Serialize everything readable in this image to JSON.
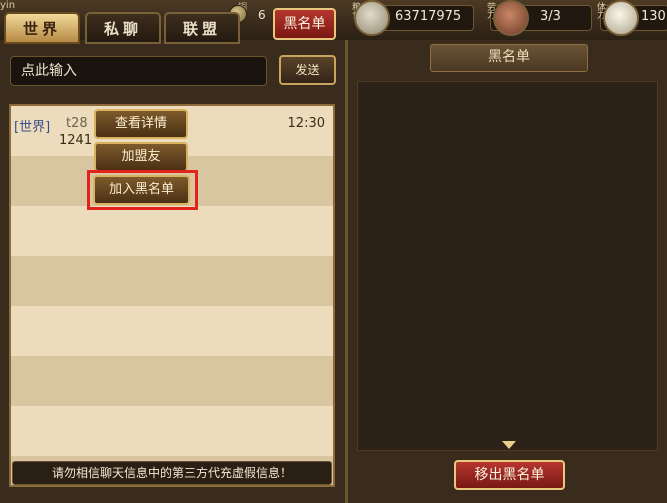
{
  "hud": {
    "fragment_label": "yin",
    "coin_label": "铜",
    "coin_value": "6",
    "blacklist_button": "黑名单",
    "resources": [
      {
        "name": "grain",
        "label": "粮食",
        "value": "63717975",
        "icon": "grain-sack-icon",
        "color": "#c9c1a8"
      },
      {
        "name": "labor",
        "label": "劳力",
        "value": "3/3",
        "icon": "worker-icon",
        "color": "#a7664a"
      },
      {
        "name": "stamina",
        "label": "体力",
        "value": "130",
        "icon": "dumpling-icon",
        "color": "#eee6d0"
      }
    ]
  },
  "tabs": [
    "世界",
    "私聊",
    "联盟"
  ],
  "active_tab": 0,
  "chat_input": {
    "placeholder": "点此输入"
  },
  "send_label": "发送",
  "messages": [
    {
      "channel": "[世界]",
      "sender": "t28",
      "time": "12:30",
      "text": "1241"
    }
  ],
  "context_menu": [
    "查看详情",
    "加盟友",
    "加入黑名单"
  ],
  "highlighted_menu_index": 2,
  "warning": "请勿相信聊天信息中的第三方代充虚假信息！",
  "blacklist": {
    "title": "黑名单",
    "remove_button": "移出黑名单",
    "entries": []
  }
}
